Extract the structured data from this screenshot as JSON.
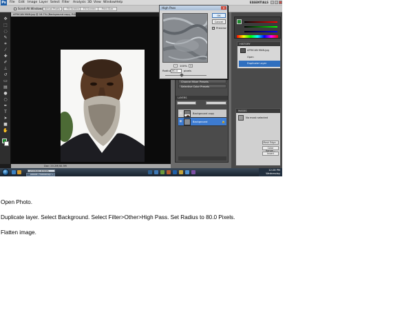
{
  "app": {
    "logo": "Ps",
    "menus": [
      "File",
      "Edit",
      "Image",
      "Layer",
      "Select",
      "Filter",
      "Analysis",
      "3D",
      "View",
      "Window",
      "Help"
    ],
    "workspace": "ESSENTIALS",
    "options_bar": {
      "scroll_all_windows_label": "Scroll All Windows",
      "buttons": [
        "Actual Pixels",
        "Fit Screen",
        "Fill Screen",
        "Print Size"
      ]
    }
  },
  "document": {
    "tab_title": "AFRICAN MAN.jpg @ 16.7% (Background copy, RGB/8*)",
    "status": "Doc: 20.2M/40.3M"
  },
  "dialog": {
    "title": "High Pass",
    "ok_label": "OK",
    "cancel_label": "Cancel",
    "preview_label": "Preview",
    "preview_checked": "✓",
    "zoom_value": "100%",
    "radius_label": "Radius:",
    "radius_value": "80.0",
    "radius_unit": "pixels",
    "radius_slider_fraction": 0.4
  },
  "adjustments_rows": [
    "Channel Mixer Presets",
    "Selective Color Presets"
  ],
  "layers_panel": {
    "title": "LAYERS",
    "layers": [
      {
        "name": "Background copy",
        "selected": false
      },
      {
        "name": "Background",
        "selected": true
      }
    ]
  },
  "history_panel": {
    "title": "HISTORY",
    "snapshot": "AFRICAN MAN.jpg",
    "items": [
      {
        "name": "Open",
        "selected": false
      },
      {
        "name": "Duplicate Layer",
        "selected": true
      }
    ]
  },
  "actions_panel": {
    "title": "MASKS",
    "label": "No mask selected",
    "buttons": [
      "Mask Edge...",
      "Color Range...",
      "Invert"
    ]
  },
  "taskbar": {
    "search_text": "Uninstall Brands",
    "task_label": "Adobe Photoshop C...",
    "clock_time": "12:28 PM",
    "clock_day": "Wednesday"
  },
  "colors": {
    "foreground": "#1f8a2f",
    "background": "#ffffff",
    "selection": "#2f6fbf"
  },
  "instructions": [
    "Open Photo.",
    "Duplicate layer. Select Background.  Select Filter>Other>High Pass. Set Radius to 80.0 Pixels.",
    "Flatten image."
  ]
}
